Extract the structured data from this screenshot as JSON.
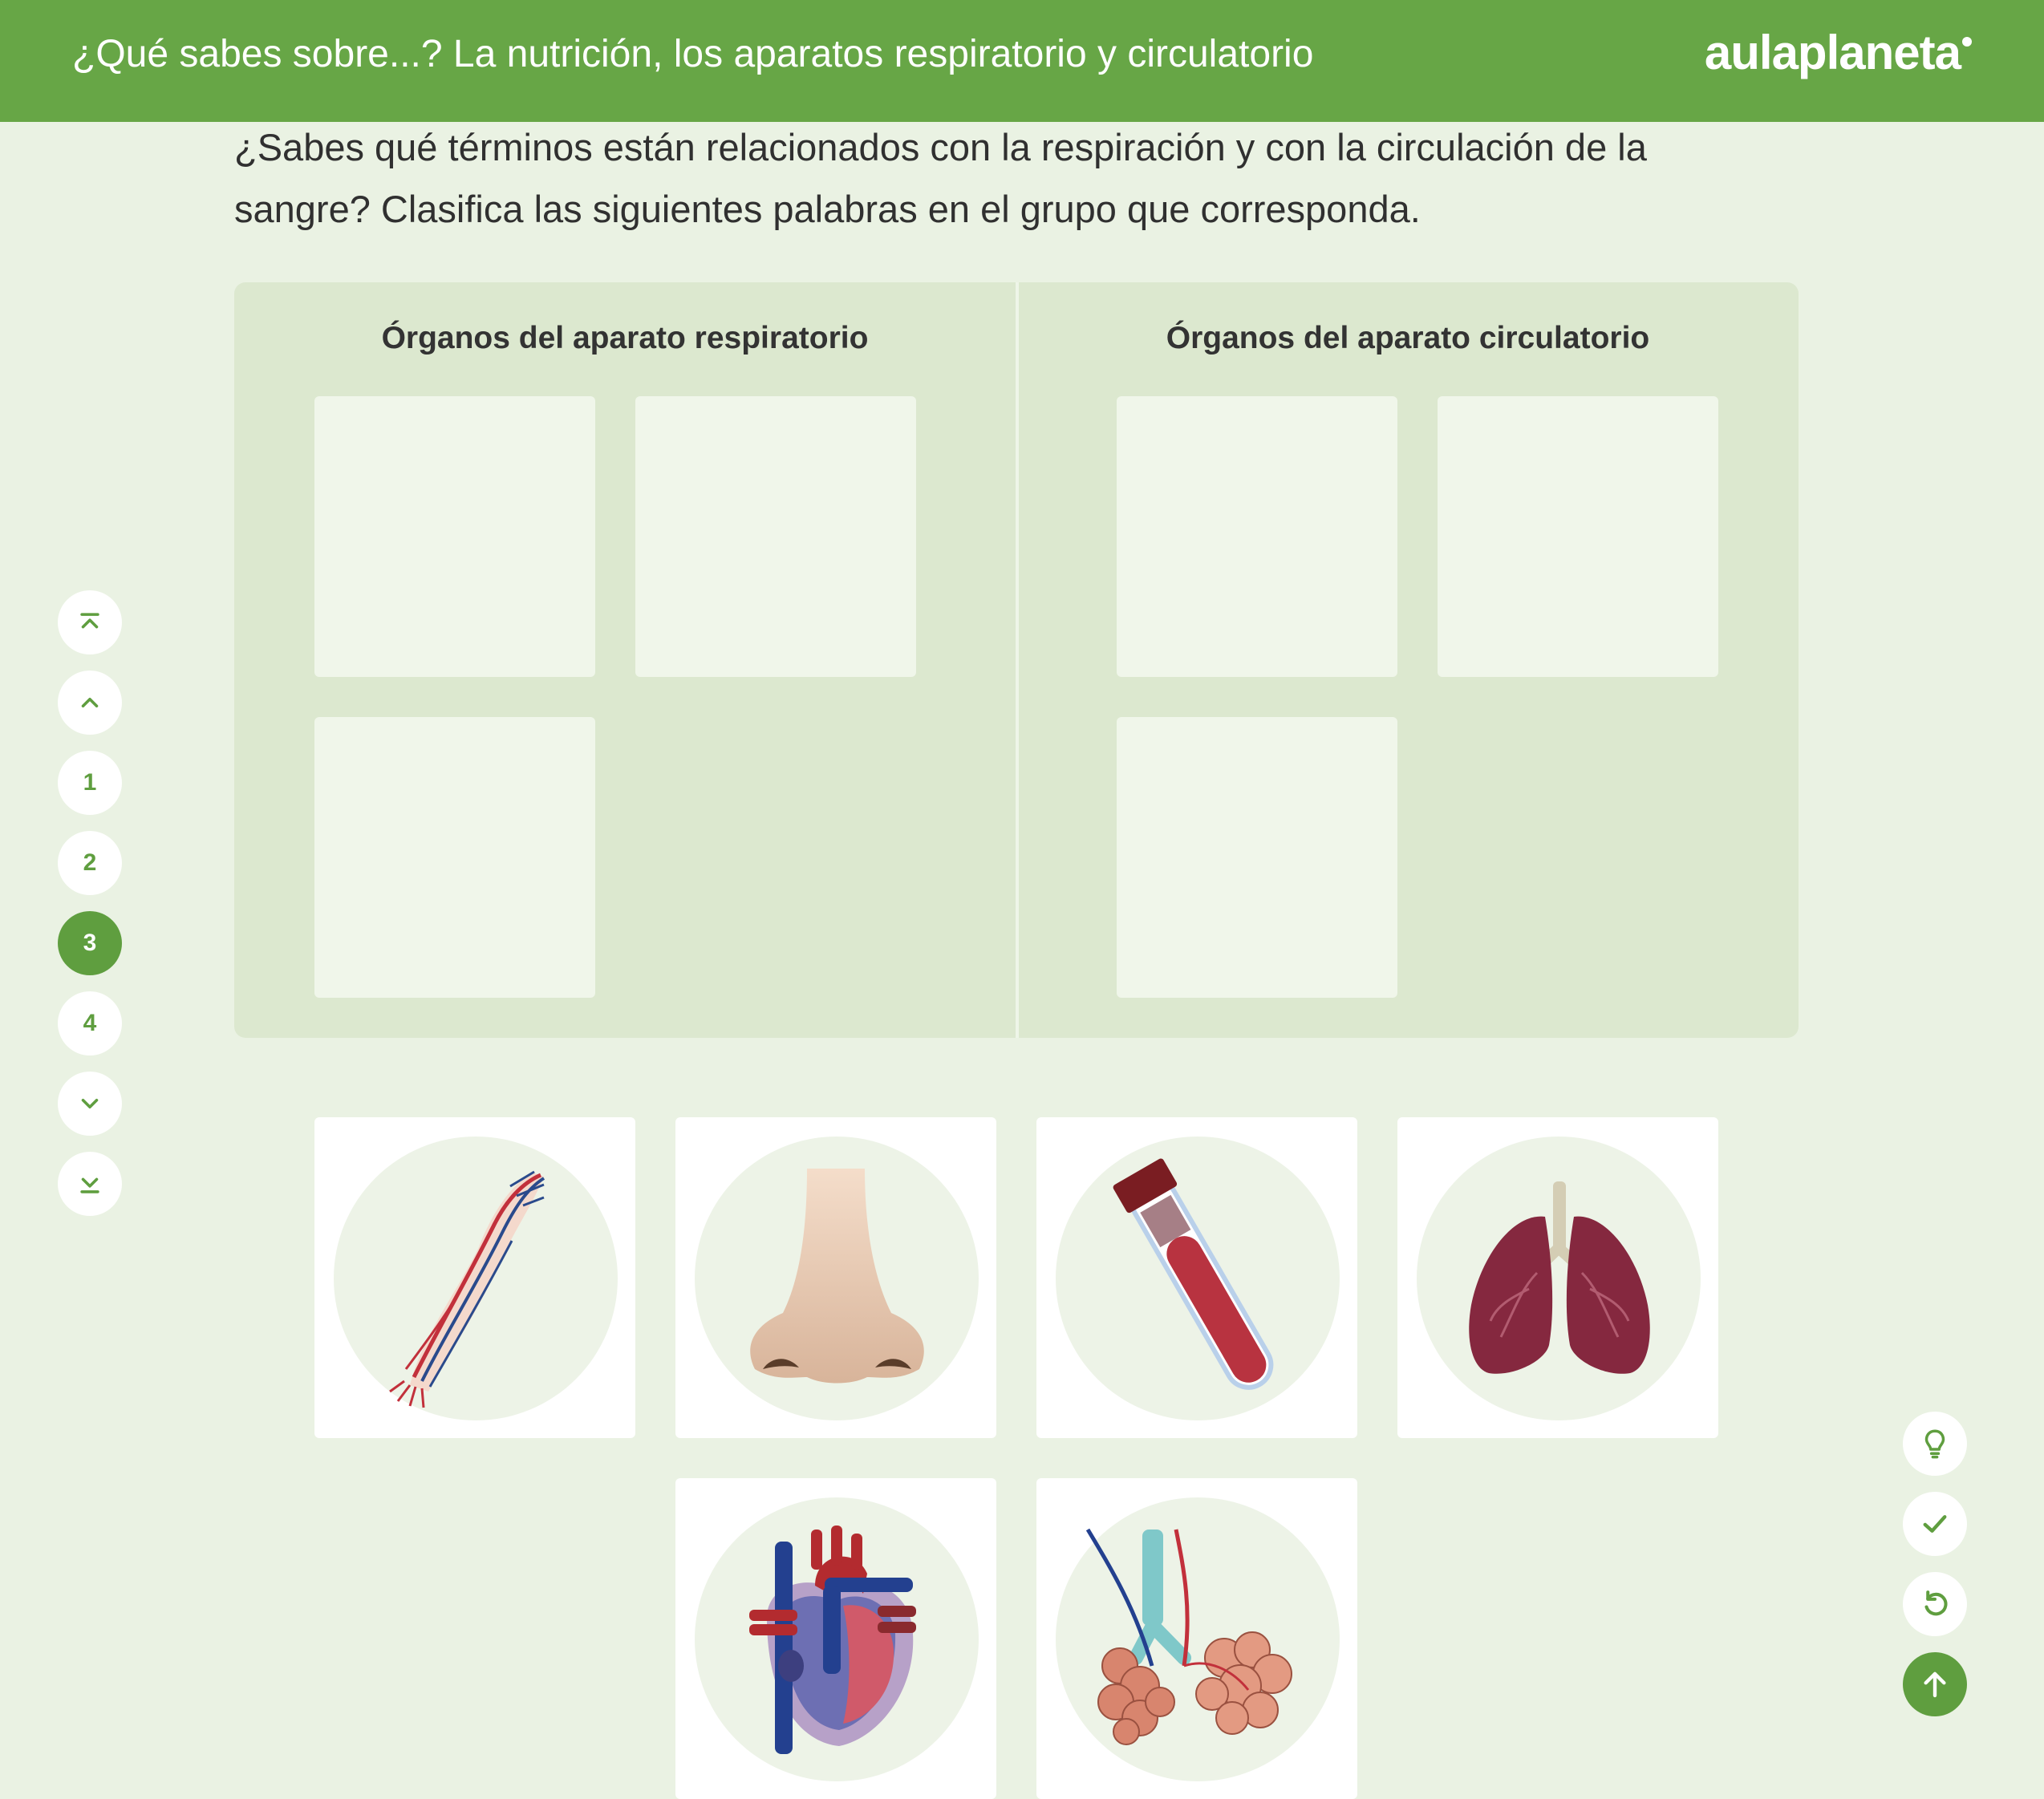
{
  "header": {
    "title": "¿Qué sabes sobre...? La nutrición, los aparatos respiratorio y circulatorio",
    "logo": "aulaplaneta"
  },
  "instruction": "¿Sabes qué términos están relacionados con la respiración y con la circulación de la sangre? Clasifica las siguientes palabras en el grupo que corresponda.",
  "board": {
    "groups": [
      {
        "title": "Órganos del aparato respiratorio",
        "slots": 3
      },
      {
        "title": "Órganos del aparato circulatorio",
        "slots": 3
      }
    ]
  },
  "cards": [
    {
      "icon": "arm-blood-vessels-icon"
    },
    {
      "icon": "nose-icon"
    },
    {
      "icon": "blood-test-tube-icon"
    },
    {
      "icon": "lungs-icon"
    },
    {
      "icon": "heart-icon"
    },
    {
      "icon": "pulmonary-alveoli-icon"
    }
  ],
  "pagination": {
    "pages": [
      "1",
      "2",
      "3",
      "4"
    ],
    "current": "3"
  },
  "tools": [
    "lightbulb-hint-icon",
    "check-icon",
    "reset-icon",
    "arrow-up-icon"
  ],
  "colors": {
    "brand_green": "#67a646",
    "accent_green": "#5f9e3f",
    "page_background": "#eaf2e3",
    "board_background": "#dce8cf",
    "slot_background": "#f0f6ea"
  }
}
